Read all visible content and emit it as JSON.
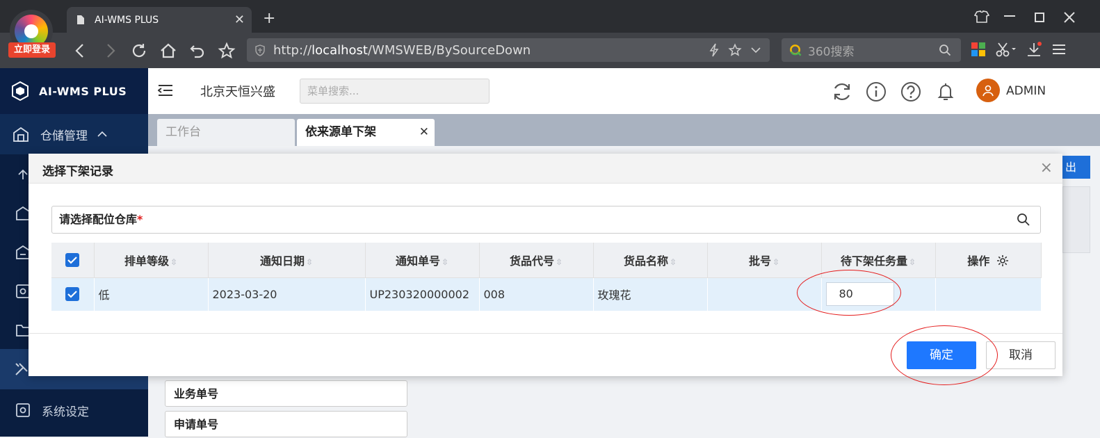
{
  "browser": {
    "badge": "立即登录",
    "tab_title": "AI-WMS PLUS",
    "url_prefix": "http://",
    "url_host": "localhost",
    "url_path": "/WMSWEB/BySourceDown",
    "search_placeholder": "360搜索"
  },
  "app": {
    "brand": "AI-WMS PLUS",
    "company": "北京天恒兴盛",
    "menu_search_placeholder": "菜单搜索...",
    "username": "ADMIN",
    "sidebar": {
      "group_label": "仓储管理",
      "settings_label": "系统设定"
    },
    "tabs": [
      "工作台",
      "依来源单下架"
    ],
    "bg_fields": [
      "业务单号",
      "申请单号"
    ],
    "edge_button": "出"
  },
  "modal": {
    "title": "选择下架记录",
    "warehouse_placeholder": "请选择配位仓库",
    "required_mark": "*",
    "columns": [
      "排单等级",
      "通知日期",
      "通知单号",
      "货品代号",
      "货品名称",
      "批号",
      "待下架任务量",
      "操作"
    ],
    "rows": [
      {
        "level": "低",
        "date": "2023-03-20",
        "notice_no": "UP230320000002",
        "item_code": "008",
        "item_name": "玫瑰花",
        "batch": "",
        "qty": "80"
      }
    ],
    "ok_label": "确定",
    "cancel_label": "取消"
  }
}
